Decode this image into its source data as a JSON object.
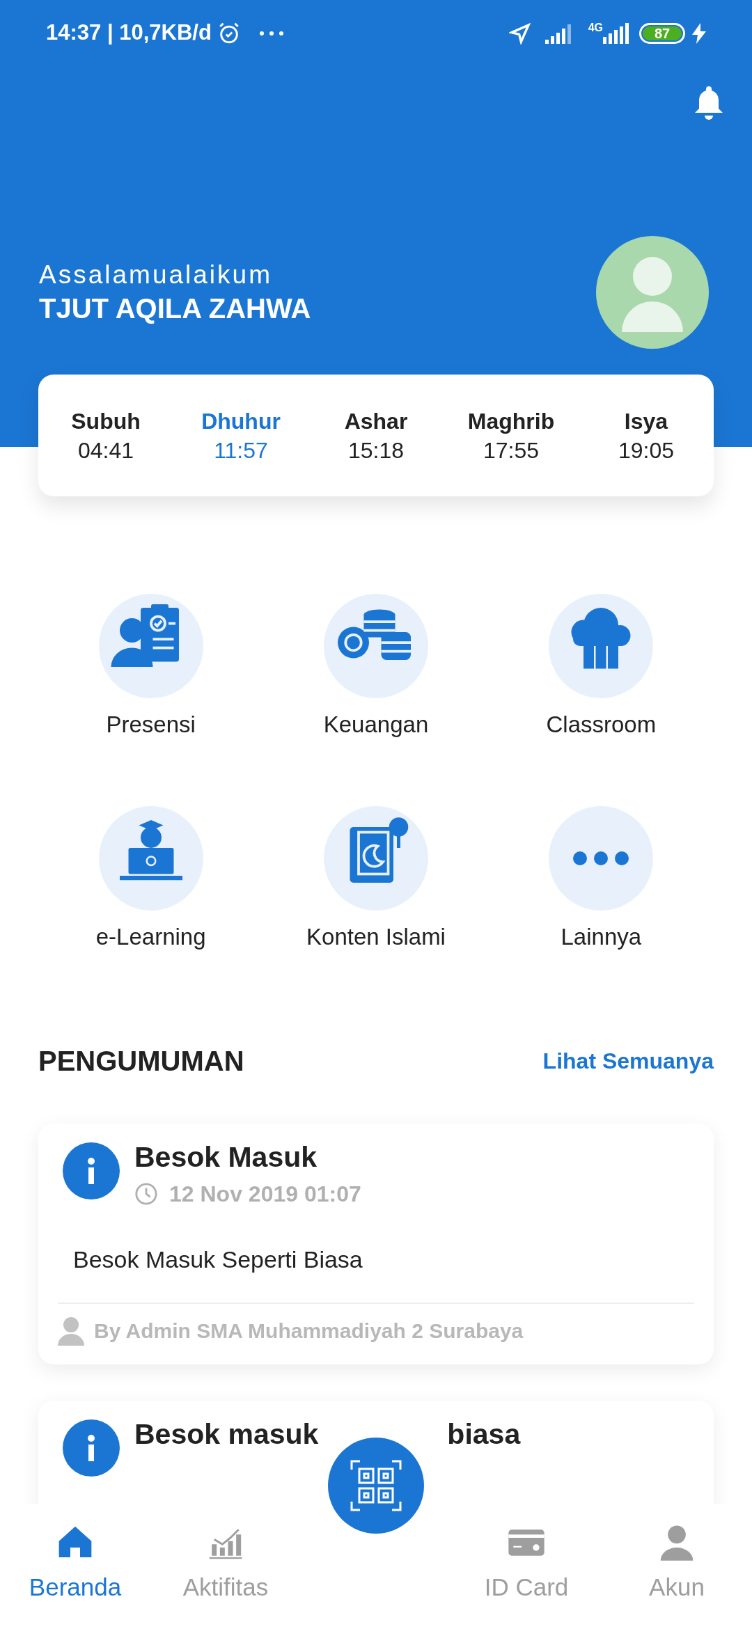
{
  "status_bar": {
    "time_and_rate": "14:37 | 10,7KB/d",
    "network": "4G",
    "battery": "87"
  },
  "header": {
    "greeting": "Assalamualaikum",
    "name": "TJUT AQILA ZAHWA"
  },
  "prayer_times": [
    {
      "name": "Subuh",
      "time": "04:41",
      "selected": false
    },
    {
      "name": "Dhuhur",
      "time": "11:57",
      "selected": true
    },
    {
      "name": "Ashar",
      "time": "15:18",
      "selected": false
    },
    {
      "name": "Maghrib",
      "time": "17:55",
      "selected": false
    },
    {
      "name": "Isya",
      "time": "19:05",
      "selected": false
    }
  ],
  "menu": [
    {
      "kind": "attendance",
      "label": "Presensi"
    },
    {
      "kind": "coins",
      "label": "Keuangan"
    },
    {
      "kind": "cloud",
      "label": "Classroom"
    },
    {
      "kind": "laptop",
      "label": "e-Learning"
    },
    {
      "kind": "book",
      "label": "Konten Islami"
    },
    {
      "kind": "more",
      "label": "Lainnya"
    }
  ],
  "announcements": {
    "title": "PENGUMUMAN",
    "see_all": "Lihat Semuanya",
    "items": [
      {
        "title": "Besok Masuk",
        "date": "12 Nov 2019 01:07",
        "body": "Besok Masuk Seperti Biasa",
        "author": "By Admin SMA Muhammadiyah 2 Surabaya"
      },
      {
        "title_parts": [
          "Besok masuk",
          "biasa"
        ]
      }
    ]
  },
  "bottom_nav": [
    {
      "kind": "home",
      "label": "Beranda",
      "selected": true
    },
    {
      "kind": "chart",
      "label": "Aktifitas",
      "selected": false
    },
    {
      "kind": "scan"
    },
    {
      "kind": "card",
      "label": "ID Card",
      "selected": false
    },
    {
      "kind": "user",
      "label": "Akun",
      "selected": false
    }
  ]
}
